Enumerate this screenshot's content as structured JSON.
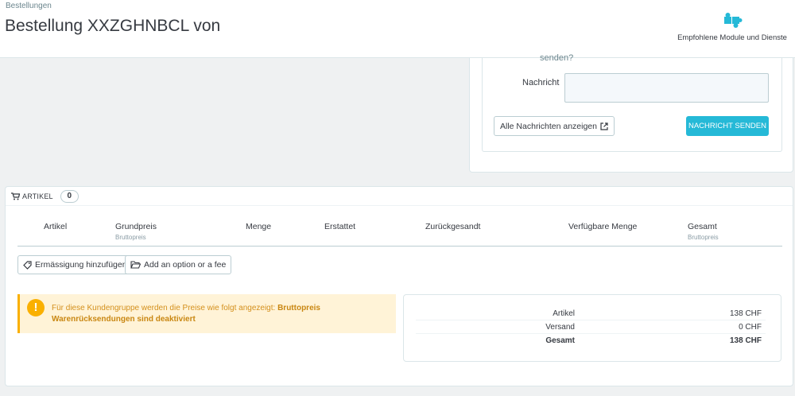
{
  "header": {
    "breadcrumb": "Bestellungen",
    "title": "Bestellung XXZGHNBCL von",
    "module_link_label": "Empfohlene Module und Dienste"
  },
  "messages": {
    "cut_label": "senden?",
    "message_label": "Nachricht",
    "message_value": "",
    "show_all_label": "Alle Nachrichten anzeigen",
    "send_label": "NACHRICHT SENDEN"
  },
  "articles": {
    "title": "ARTIKEL",
    "count": "0",
    "columns": [
      {
        "label": "Artikel",
        "sub": ""
      },
      {
        "label": "Grundpreis",
        "sub": "Bruttopreis"
      },
      {
        "label": "Menge",
        "sub": ""
      },
      {
        "label": "Erstattet",
        "sub": ""
      },
      {
        "label": "Zurückgesandt",
        "sub": ""
      },
      {
        "label": "Verfügbare Menge",
        "sub": ""
      },
      {
        "label": "Gesamt",
        "sub": "Bruttopreis"
      }
    ],
    "add_discount_label": "Ermässigung hinzufügen",
    "add_option_label": "Add an option or a fee",
    "alert": {
      "text": "Für diese Kundengruppe werden die Preise wie folgt angezeigt: ",
      "price_mode": "Bruttopreis",
      "returns": "Warenrücksendungen sind deaktiviert"
    },
    "totals": {
      "products_label": "Artikel",
      "products_value": "138 CHF",
      "shipping_label": "Versand",
      "shipping_value": "0 CHF",
      "total_label": "Gesamt",
      "total_value": "138 CHF"
    }
  },
  "colors": {
    "accent": "#25b9d7",
    "warning": "#fab000",
    "warning_bg": "#fff3d7"
  }
}
